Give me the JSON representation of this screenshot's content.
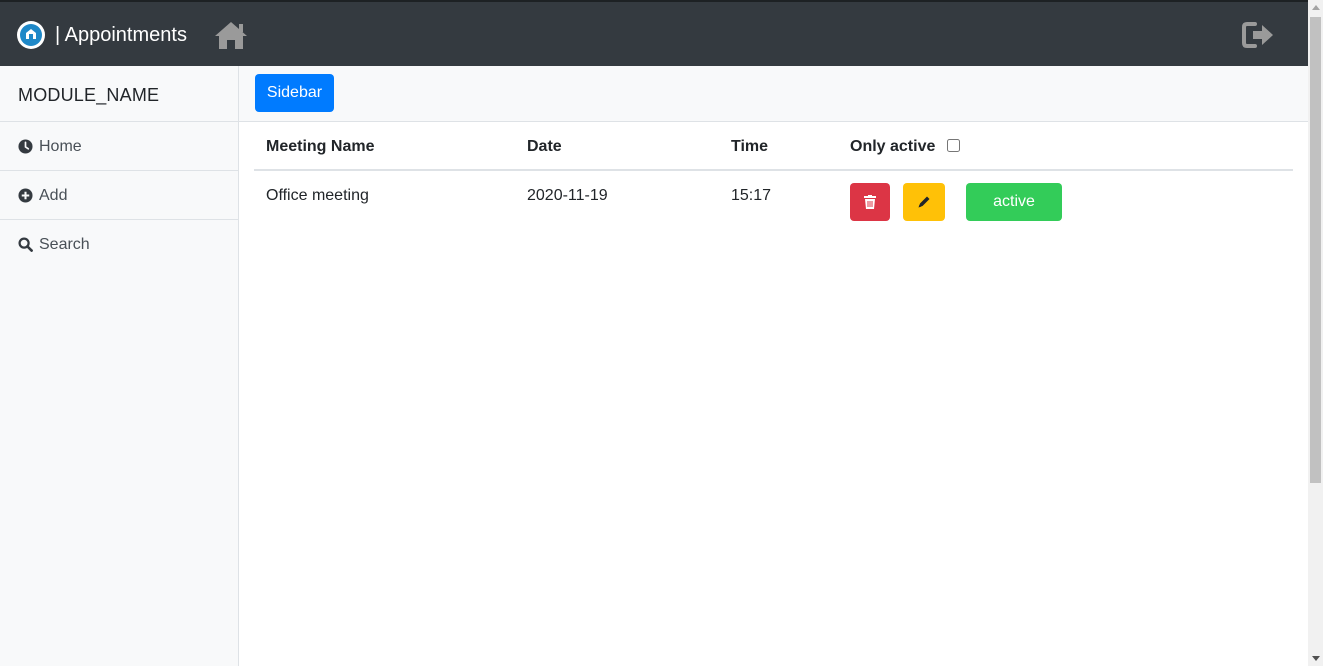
{
  "header": {
    "title": "| Appointments",
    "home_icon": "home-icon",
    "logout_icon": "sign-out-icon",
    "background": "#343a40"
  },
  "sidebar": {
    "module_name": "MODULE_NAME",
    "items": [
      {
        "label": "Home",
        "icon": "clock-icon"
      },
      {
        "label": "Add",
        "icon": "plus-circle-icon"
      },
      {
        "label": "Search",
        "icon": "search-icon"
      }
    ]
  },
  "main": {
    "sidebar_button_label": "Sidebar",
    "table": {
      "headers": {
        "name": "Meeting Name",
        "date": "Date",
        "time": "Time",
        "only_active": "Only active"
      },
      "only_active_checked": false,
      "rows": [
        {
          "name": "Office meeting",
          "date": "2020-11-19",
          "time": "15:17",
          "status_label": "active"
        }
      ]
    }
  },
  "colors": {
    "primary": "#007bff",
    "danger": "#dc3545",
    "warning": "#ffc107",
    "success": "#33cc59"
  }
}
